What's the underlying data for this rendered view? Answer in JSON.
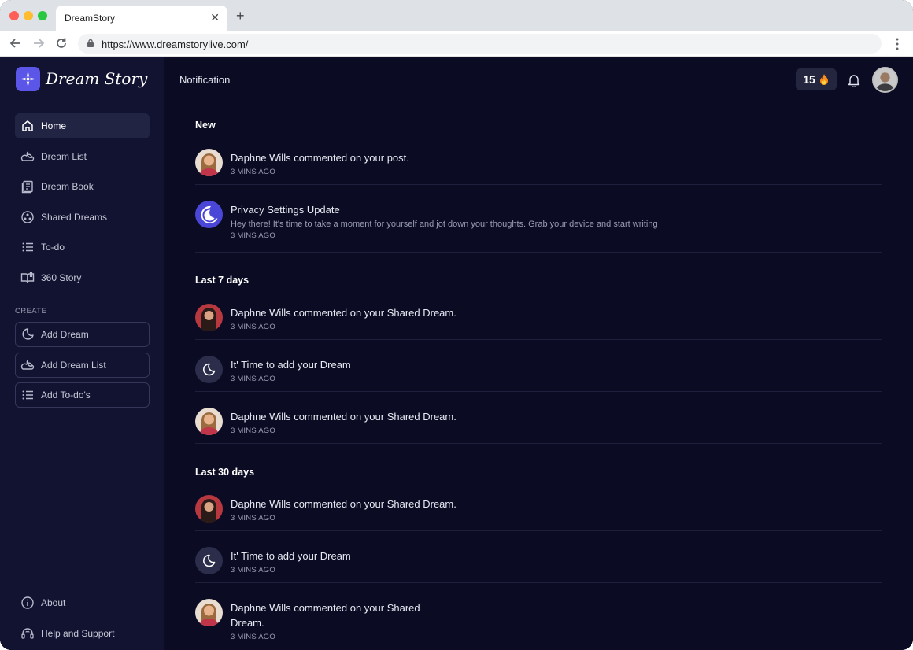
{
  "browser": {
    "tab_title": "DreamStory",
    "url": "https://www.dreamstorylive.com/"
  },
  "brand": {
    "name": "Dream Story"
  },
  "sidebar": {
    "nav": [
      {
        "label": "Home",
        "icon": "home-icon",
        "active": true
      },
      {
        "label": "Dream List",
        "icon": "moon-cloud-icon"
      },
      {
        "label": "Dream Book",
        "icon": "book-icon"
      },
      {
        "label": "Shared Dreams",
        "icon": "shared-icon"
      },
      {
        "label": "To-do",
        "icon": "list-icon"
      },
      {
        "label": "360 Story",
        "icon": "open-book-icon"
      }
    ],
    "create_heading": "CREATE",
    "create": [
      {
        "label": "Add Dream",
        "icon": "moon-icon"
      },
      {
        "label": "Add Dream List",
        "icon": "moon-cloud-icon"
      },
      {
        "label": "Add To-do's",
        "icon": "list-icon"
      }
    ],
    "footer": [
      {
        "label": "About",
        "icon": "info-icon"
      },
      {
        "label": "Help and Support",
        "icon": "headset-icon"
      }
    ]
  },
  "header": {
    "title": "Notification",
    "streak_count": "15"
  },
  "sections": [
    {
      "title": "New",
      "items": [
        {
          "title": "Daphne Wills commented on your post.",
          "time": "3 MINS AGO",
          "avatar": "user-photo"
        },
        {
          "title": "Privacy Settings Update",
          "desc": "Hey there! It's time to take a moment for yourself and jot down your thoughts. Grab your device and start writing",
          "time": "3 MINS AGO",
          "avatar": "privacy-moon-icon"
        }
      ]
    },
    {
      "title": "Last 7 days",
      "items": [
        {
          "title": "Daphne Wills commented on your Shared Dream.",
          "time": "3 MINS AGO",
          "avatar": "user-photo"
        },
        {
          "title": "It' Time to add your Dream",
          "time": "3 MINS AGO",
          "avatar": "moon-icon"
        },
        {
          "title": "Daphne Wills commented on your Shared Dream.",
          "time": "3 MINS AGO",
          "avatar": "user-photo"
        }
      ]
    },
    {
      "title": "Last 30 days",
      "items": [
        {
          "title": "Daphne Wills commented on your Shared Dream.",
          "time": "3 MINS AGO",
          "avatar": "user-photo"
        },
        {
          "title": "It' Time to add your Dream",
          "time": "3 MINS AGO",
          "avatar": "moon-icon"
        },
        {
          "title": "Daphne Wills commented on your Shared\nDream.",
          "time": "3 MINS AGO",
          "avatar": "user-photo"
        }
      ]
    }
  ],
  "colors": {
    "background": "#0b0c24",
    "sidebar": "#121331",
    "accent": "#5b56e8"
  }
}
